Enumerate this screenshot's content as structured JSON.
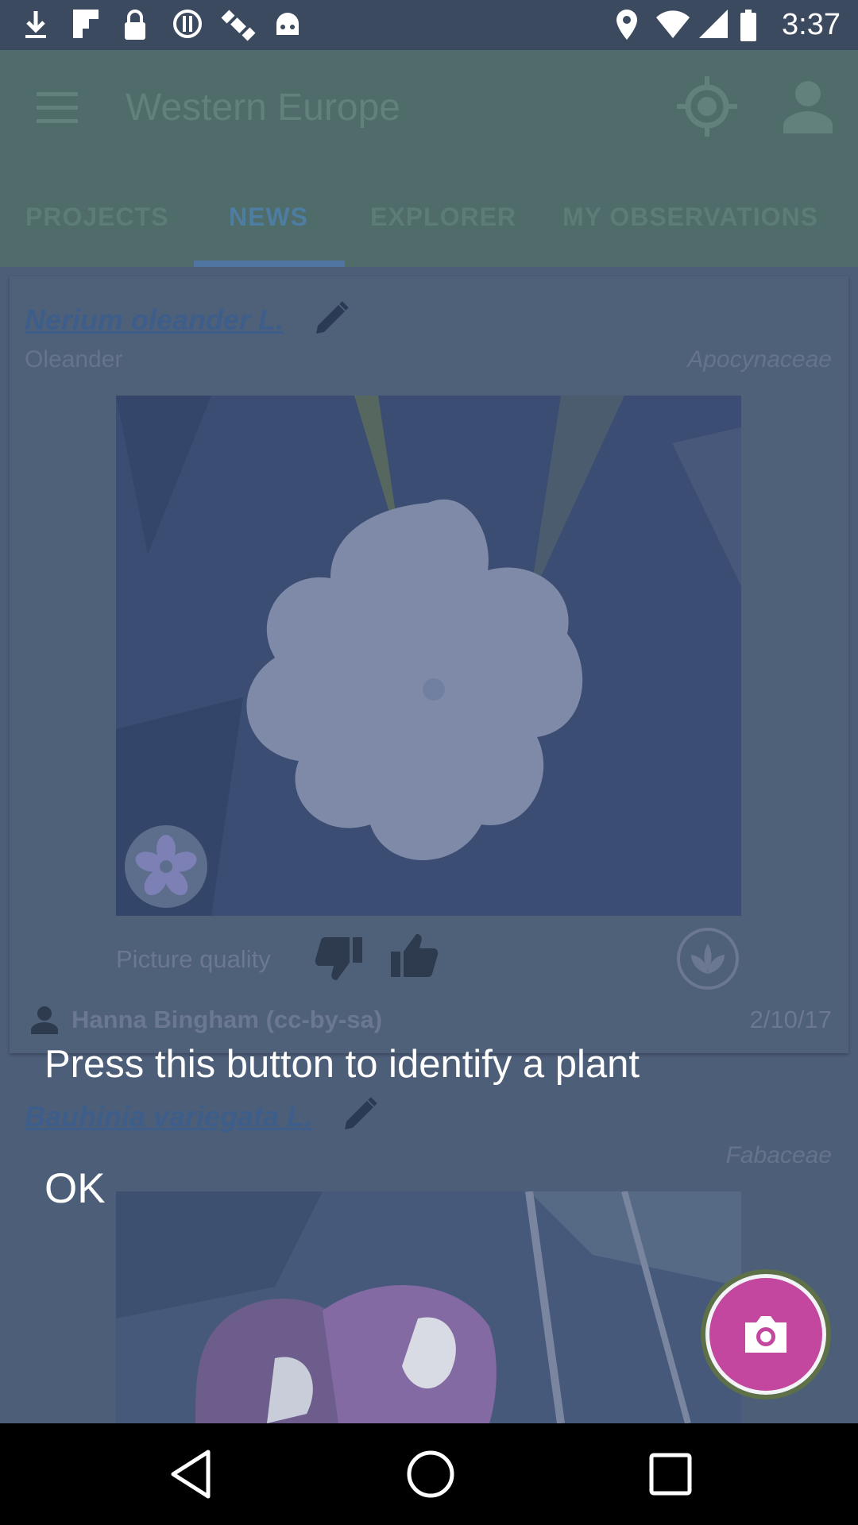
{
  "status_bar": {
    "time": "3:37",
    "left_icons": [
      "download-icon",
      "flipboard-icon",
      "lock-icon",
      "alert-icon",
      "satellite-icon",
      "android-icon"
    ],
    "right_icons": [
      "location-pin-icon",
      "wifi-icon",
      "signal-icon",
      "battery-icon"
    ]
  },
  "app_bar": {
    "title": "Western Europe",
    "tabs": [
      {
        "label": "PROJECTS",
        "selected": false
      },
      {
        "label": "NEWS",
        "selected": true
      },
      {
        "label": "EXPLORER",
        "selected": false
      },
      {
        "label": "MY OBSERVATIONS",
        "selected": false
      }
    ]
  },
  "cards": [
    {
      "scientific_name": "Nerium oleander L.",
      "common_name": "Oleander",
      "family": "Apocynaceae",
      "quality_label": "Picture quality",
      "author": "Hanna Bingham (cc-by-sa)",
      "date": "2/10/17"
    },
    {
      "scientific_name": "Bauhinia variegata L.",
      "family": "Fabaceae"
    }
  ],
  "overlay": {
    "hint": "Press this button to identify a plant",
    "ok_label": "OK"
  },
  "colors": {
    "app_bar": "#4f6b6a",
    "content": "#4d5e78",
    "fab": "#c3479f",
    "accent_link": "#3d5d8a"
  }
}
